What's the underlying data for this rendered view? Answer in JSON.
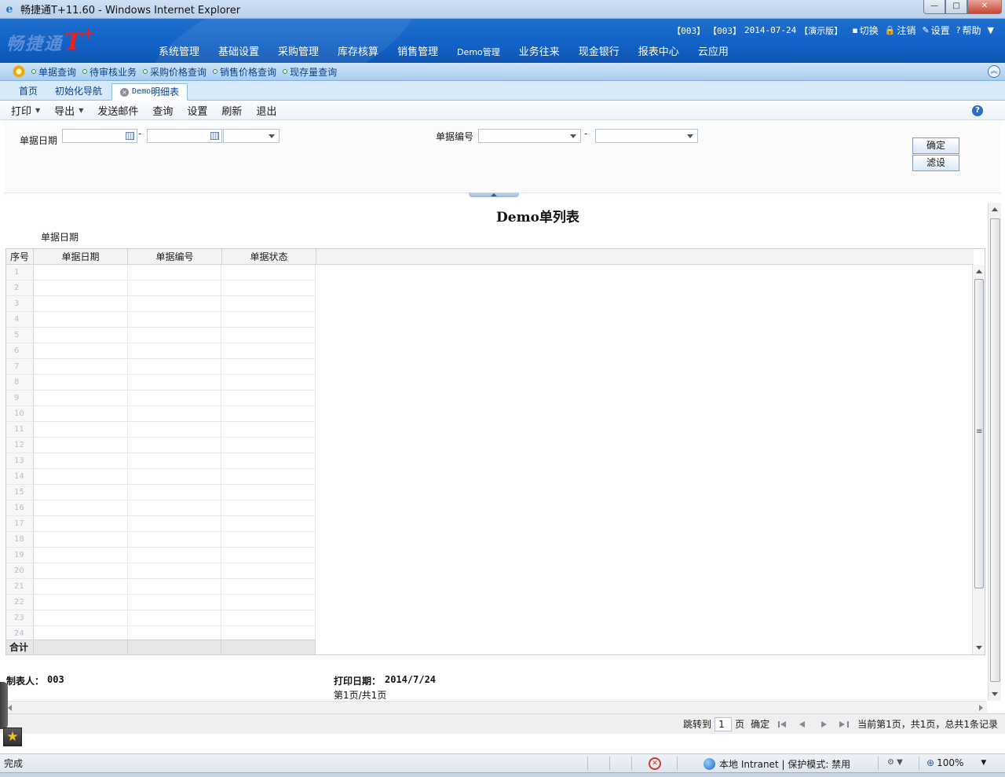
{
  "window": {
    "title": "畅捷通T+11.60 - Windows Internet Explorer",
    "minimize": "—",
    "maximize": "□",
    "close": "✕"
  },
  "header": {
    "logo_text": "畅捷通",
    "logo_brand": "T",
    "logo_plus": "+",
    "account_1": "【003】",
    "account_2": "【003】",
    "date": "2014-07-24",
    "edition": "【演示版】",
    "links": [
      {
        "label": "切换",
        "icon": "switch-icon"
      },
      {
        "label": "注销",
        "icon": "lock-icon"
      },
      {
        "label": "设置",
        "icon": "settings-icon"
      },
      {
        "label": "帮助",
        "icon": "help-icon"
      }
    ]
  },
  "main_nav": [
    "系统管理",
    "基础设置",
    "采购管理",
    "库存核算",
    "销售管理",
    "Demo管理",
    "业务往来",
    "现金银行",
    "报表中心",
    "云应用"
  ],
  "quick_links": [
    "单据查询",
    "待审核业务",
    "采购价格查询",
    "销售价格查询",
    "现存量查询"
  ],
  "tabs": {
    "home": "首页",
    "init_guide": "初始化导航",
    "active_prefix": "Demo",
    "active_suffix": "明细表",
    "close": "×"
  },
  "toolbar": {
    "print": "打印",
    "export": "导出",
    "send_mail": "发送邮件",
    "query": "查询",
    "settings": "设置",
    "refresh": "刷新",
    "exit": "退出",
    "help": "?"
  },
  "filter": {
    "date_label": "单据日期",
    "date_from": "",
    "date_to": "",
    "date_range_select": "",
    "range_sep": "-",
    "code_label": "单据编号",
    "code_from": "",
    "code_to": "",
    "confirm": "确定",
    "filter_settings": "滤设"
  },
  "report": {
    "title": "Demo单列表",
    "sub_label": "单据日期",
    "columns": [
      "序号",
      "单据日期",
      "单据编号",
      "单据状态"
    ],
    "row_numbers": [
      "1",
      "2",
      "3",
      "4",
      "5",
      "6",
      "7",
      "8",
      "9",
      "10",
      "11",
      "12",
      "13",
      "14",
      "15",
      "16",
      "17",
      "18",
      "19",
      "20",
      "21",
      "22",
      "23",
      "24"
    ],
    "total_label": "合计",
    "maker_label": "制表人：",
    "maker_value": "003",
    "print_date_label": "打印日期：",
    "print_date_value": "2014/7/24",
    "page_info": "第1页/共1页"
  },
  "pager": {
    "jump_to": "跳转到",
    "page_value": "1",
    "page_unit": "页",
    "confirm": "确定",
    "summary": "当前第1页，共1页，总共1条记录"
  },
  "statusbar": {
    "status": "完成",
    "zone": "本地 Intranet | 保护模式: 禁用",
    "zoom": "100%"
  }
}
